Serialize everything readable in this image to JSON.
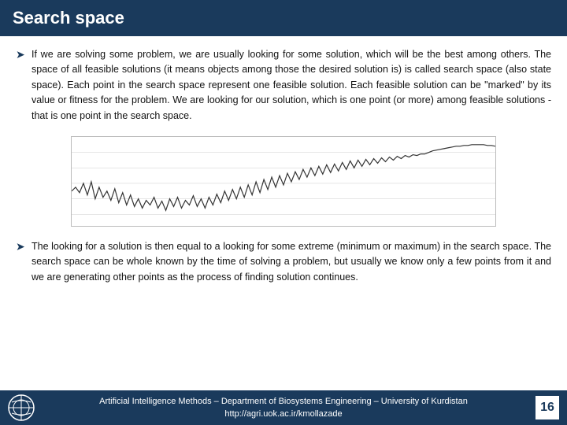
{
  "header": {
    "title": "Search space"
  },
  "content": {
    "bullet1": "If we are solving some problem, we are usually looking for some solution, which will be the best among others. The space of all feasible solutions (it means objects among those the desired solution is) is called search space (also state space). Each point in the search space represent one feasible solution. Each feasible solution can be \"marked\" by its value or fitness for the problem. We are looking for our solution, which is one point (or more) among feasible solutions - that is one point in the search space.",
    "bullet2": "The looking for a solution is then equal to a looking for some extreme (minimum or maximum) in the search space. The search space can be whole known by the time of solving a problem, but usually we know only a few points from it and we are generating other points as the process of finding solution continues."
  },
  "footer": {
    "line1": "Artificial Intelligence Methods – Department of Biosystems Engineering – University of Kurdistan",
    "line2": "http://agri.uok.ac.ir/kmollazade",
    "page": "16"
  }
}
